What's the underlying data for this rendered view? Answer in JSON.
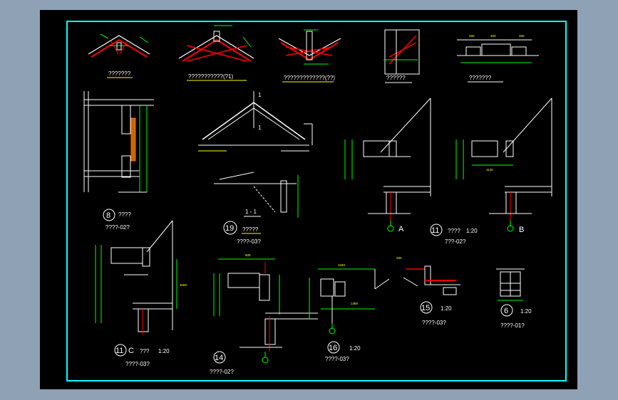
{
  "colors": {
    "background_frame": "#8ea1b5",
    "canvas": "#000000",
    "border": "#00ffff",
    "line_white": "#ffffff",
    "line_green": "#00ff00",
    "line_red": "#ff0000",
    "line_yellow": "#ffff00"
  },
  "titles": {
    "t1": "???????",
    "t2": "???????????(?1)",
    "t3": "?????????????(??)",
    "t4": "??????",
    "t5": "???????",
    "d8_num": "8",
    "d8_label": "????",
    "d8_ref": "????-02?",
    "d19_num": "19",
    "d19_label": "?????",
    "d19_ref": "????-03?",
    "section_1": "1 - 1",
    "d11_num": "11",
    "d11_label": "????",
    "d11_scale": "1:20",
    "d11_ref": "7??-02?",
    "axis_a": "A",
    "axis_b": "B",
    "d11c_num": "11",
    "d11c_letter": "C",
    "d11c_label": "???",
    "d11c_scale": "1:20",
    "d11c_ref": "????-03?",
    "d14_num": "14",
    "d14_ref": "????-02?",
    "d16_num": "16",
    "d16_scale": "1:20",
    "d16_ref": "????-03?",
    "d15_num": "15",
    "d15_scale": "1:20",
    "d15_ref": "????-03?",
    "d6_num": "6",
    "d6_scale": "1:20",
    "d6_ref": "????-01?"
  },
  "dims": {
    "d450a": "450",
    "d300": "300",
    "d450b": "450",
    "d250": "250",
    "d600": "600",
    "d2340": "2340",
    "d1380": "1380",
    "d1140": "1140",
    "d3000": "3000",
    "d1": "1",
    "d1b": "1"
  }
}
